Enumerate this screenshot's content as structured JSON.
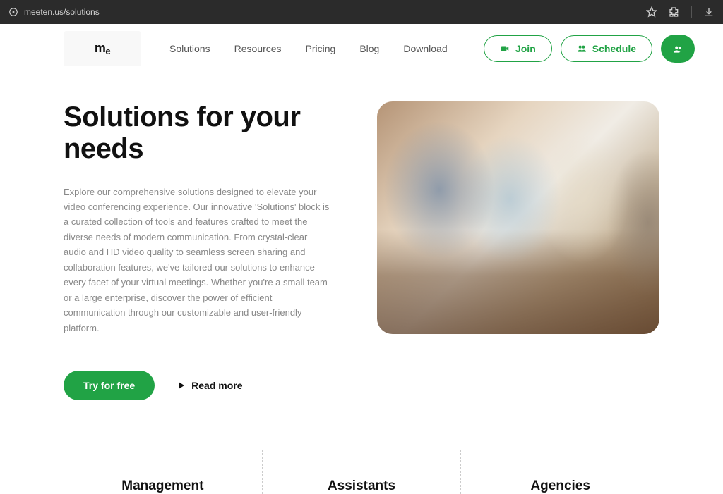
{
  "browser": {
    "url": "meeten.us/solutions"
  },
  "logo": "m",
  "logo_sub": "e",
  "nav": {
    "solutions": "Solutions",
    "resources": "Resources",
    "pricing": "Pricing",
    "blog": "Blog",
    "download": "Download"
  },
  "buttons": {
    "join": "Join",
    "schedule": "Schedule"
  },
  "hero": {
    "title": "Solutions for your needs",
    "description": "Explore our comprehensive solutions designed to elevate your video conferencing experience. Our innovative 'Solutions' block is a curated collection of tools and features crafted to meet the diverse needs of modern communication. From crystal-clear audio and HD video quality to seamless screen sharing and collaboration features, we've tailored our solutions to enhance every facet of your virtual meetings. Whether you're a small team or a large enterprise, discover the power of efficient communication through our customizable and user-friendly platform.",
    "try": "Try for free",
    "read_more": "Read more"
  },
  "categories": {
    "management": "Management",
    "assistants": "Assistants",
    "agencies": "Agencies"
  },
  "colors": {
    "accent": "#21a345"
  }
}
